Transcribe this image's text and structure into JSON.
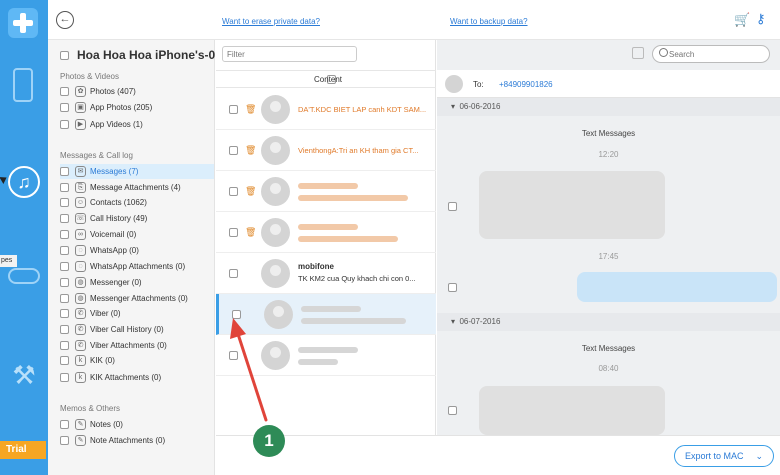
{
  "topbar": {
    "link_erase": "Want to erase private data?",
    "link_backup": "Want to backup data?"
  },
  "dock": {
    "tooltip": "pes",
    "trial": "Trial"
  },
  "sidebar": {
    "device_name": "Hoa Hoa Hoa iPhone's-0...",
    "sections": {
      "photos": "Photos & Videos",
      "messages": "Messages & Call log",
      "memos": "Memos & Others"
    },
    "items": [
      {
        "label": "Photos (407)"
      },
      {
        "label": "App Photos (205)"
      },
      {
        "label": "App Videos (1)"
      },
      {
        "label": "Messages (7)"
      },
      {
        "label": "Message Attachments (4)"
      },
      {
        "label": "Contacts (1062)"
      },
      {
        "label": "Call History (49)"
      },
      {
        "label": "Voicemail (0)"
      },
      {
        "label": "WhatsApp (0)"
      },
      {
        "label": "WhatsApp Attachments (0)"
      },
      {
        "label": "Messenger (0)"
      },
      {
        "label": "Messenger Attachments (0)"
      },
      {
        "label": "Viber (0)"
      },
      {
        "label": "Viber Call History (0)"
      },
      {
        "label": "Viber Attachments (0)"
      },
      {
        "label": "KIK (0)"
      },
      {
        "label": "KIK Attachments (0)"
      },
      {
        "label": "Notes (0)"
      },
      {
        "label": "Note Attachments (0)"
      }
    ]
  },
  "list": {
    "filter_placeholder": "Filter",
    "header": "Content",
    "rows": [
      {
        "preview": "DA'T.KDC BIET LAP canh KDT SAM..."
      },
      {
        "preview": "VienthongA:Tri an KH tham gia CT..."
      },
      {
        "name": "mobifone",
        "preview": "TK KM2 cua Quy khach chi con 0..."
      }
    ]
  },
  "search": {
    "placeholder": "Search"
  },
  "conversation": {
    "to_label": "To:",
    "number": "+84909901826",
    "dates": [
      "06-06-2016",
      "06-07-2016"
    ],
    "section_label": "Text Messages",
    "times": [
      "12:20",
      "17:45",
      "08:40"
    ]
  },
  "bottom": {
    "export_label": "Export to MAC",
    "export_chevron": "⌄"
  },
  "annotation": {
    "number": "1"
  }
}
